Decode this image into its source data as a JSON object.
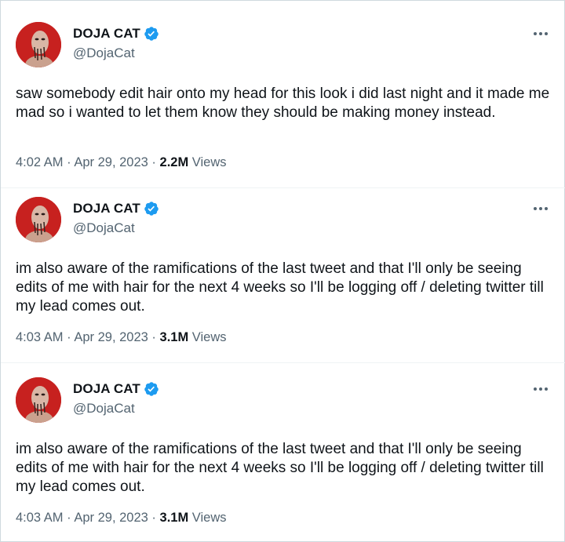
{
  "tweets": [
    {
      "display_name": "DOJA CAT",
      "handle": "@DojaCat",
      "text": "saw somebody edit hair onto my head for this look i did last night and it made me mad so i wanted to let them know they should be making money instead.",
      "time": "4:02 AM",
      "date": "Apr 29, 2023",
      "views_count": "2.2M",
      "views_label": "Views"
    },
    {
      "display_name": "DOJA CAT",
      "handle": "@DojaCat",
      "text": "im also aware of the ramifications of the last tweet and that I'll only be seeing edits of me with hair for the next 4 weeks so I'll be logging off / deleting twitter till my lead comes out.",
      "time": "4:03 AM",
      "date": "Apr 29, 2023",
      "views_count": "3.1M",
      "views_label": "Views"
    },
    {
      "display_name": "DOJA CAT",
      "handle": "@DojaCat",
      "text": "im also aware of the ramifications of the last tweet and that I'll only be seeing edits of me with hair for the next 4 weeks so I'll be logging off / deleting twitter till my lead comes out.",
      "time": "4:03 AM",
      "date": "Apr 29, 2023",
      "views_count": "3.1M",
      "views_label": "Views"
    }
  ],
  "meta_separator": "·",
  "colors": {
    "verified_badge": "#1d9bf0",
    "avatar_background": "#c7211f",
    "secondary_text": "#536471",
    "primary_text": "#0f1419"
  },
  "icons": {
    "verified": "verified-badge-icon",
    "more": "more-options-icon",
    "avatar": "profile-avatar"
  }
}
